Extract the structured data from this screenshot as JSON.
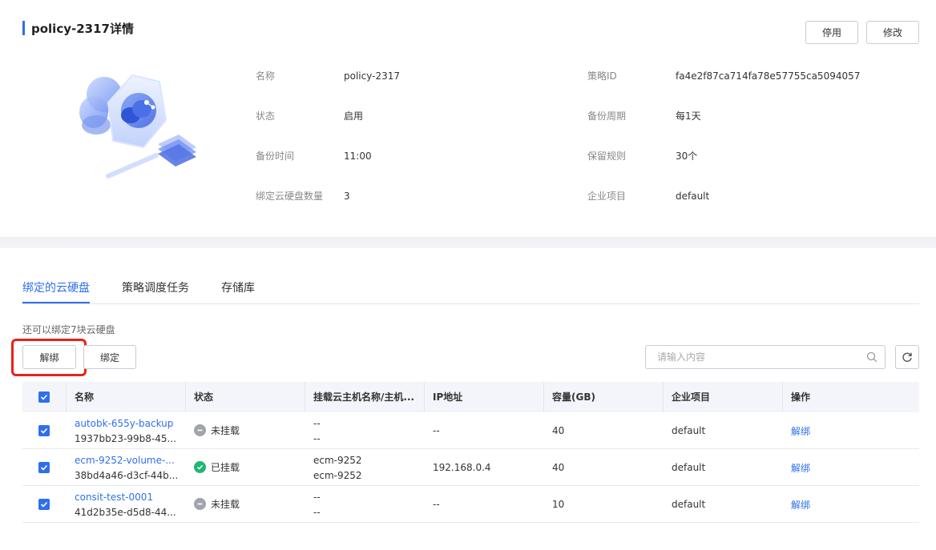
{
  "header": {
    "title": "policy-2317详情",
    "disable_label": "停用",
    "edit_label": "修改"
  },
  "details": {
    "name_label": "名称",
    "name_value": "policy-2317",
    "status_label": "状态",
    "status_value": "启用",
    "backup_time_label": "备份时间",
    "backup_time_value": "11:00",
    "disk_count_label": "绑定云硬盘数量",
    "disk_count_value": "3",
    "policy_id_label": "策略ID",
    "policy_id_value": "fa4e2f87ca714fa78e57755ca5094057",
    "cycle_label": "备份周期",
    "cycle_value": "每1天",
    "retention_label": "保留规则",
    "retention_value": "30个",
    "project_label": "企业项目",
    "project_value": "default"
  },
  "tabs": [
    {
      "label": "绑定的云硬盘"
    },
    {
      "label": "策略调度任务"
    },
    {
      "label": "存储库"
    }
  ],
  "toolbar": {
    "hint": "还可以绑定7块云硬盘",
    "unbind_label": "解绑",
    "bind_label": "绑定",
    "search_placeholder": "请输入内容"
  },
  "table": {
    "headers": [
      "名称",
      "状态",
      "挂载云主机名称/主机...",
      "IP地址",
      "容量(GB)",
      "企业项目",
      "操作"
    ],
    "rows": [
      {
        "name": "autobk-655y-backup",
        "id": "1937bb23-99b8-45...",
        "status": "未挂载",
        "status_type": "unmounted",
        "host1": "--",
        "host2": "--",
        "ip": "--",
        "capacity": "40",
        "project": "default",
        "action": "解绑"
      },
      {
        "name": "ecm-9252-volume-...",
        "id": "38bd4a46-d3cf-44b...",
        "status": "已挂载",
        "status_type": "mounted",
        "host1": "ecm-9252",
        "host2": "ecm-9252",
        "ip": "192.168.0.4",
        "capacity": "40",
        "project": "default",
        "action": "解绑"
      },
      {
        "name": "consit-test-0001",
        "id": "41d2b35e-d5d8-44...",
        "status": "未挂载",
        "status_type": "unmounted",
        "host1": "--",
        "host2": "--",
        "ip": "--",
        "capacity": "10",
        "project": "default",
        "action": "解绑"
      }
    ]
  },
  "colors": {
    "accent": "#2f6fed",
    "highlight": "#e8231a",
    "mounted": "#22b573",
    "unmounted": "#a0a4ab"
  }
}
